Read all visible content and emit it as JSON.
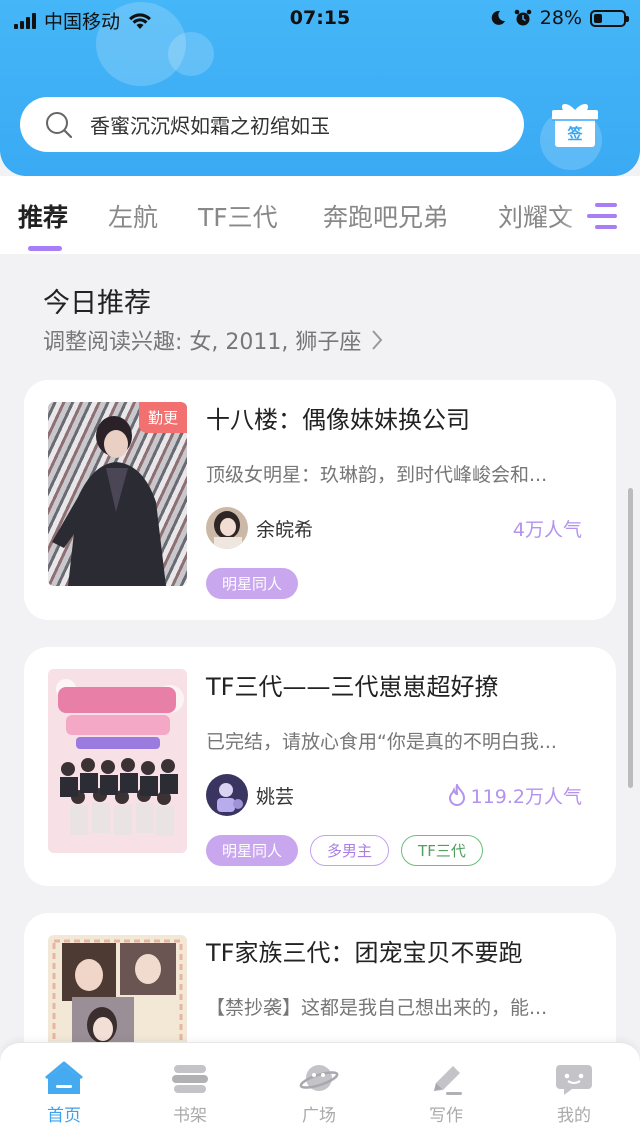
{
  "status_bar": {
    "carrier": "中国移动",
    "time": "07:15",
    "battery": "28%",
    "battery_level": 0.28
  },
  "search": {
    "placeholder": "香蜜沉沉烬如霜之初绾如玉"
  },
  "checkin": {
    "label": "签"
  },
  "tabs": [
    {
      "label": "推荐",
      "active": true
    },
    {
      "label": "左航"
    },
    {
      "label": "TF三代"
    },
    {
      "label": "奔跑吧兄弟"
    },
    {
      "label": "刘耀文"
    }
  ],
  "section": {
    "title": "今日推荐",
    "subtitle": "调整阅读兴趣: 女, 2011, 狮子座"
  },
  "books": [
    {
      "badge": "勤更",
      "title": "十八楼：偶像妹妹换公司",
      "description": "顶级女明星：玖琳韵，到时代峰峻会和...",
      "author": "余皖希",
      "popularity": "4万人气",
      "hot": false,
      "tags": [
        {
          "label": "明星同人",
          "style": "fill"
        }
      ]
    },
    {
      "badge": "",
      "title": "TF三代——三代崽崽超好撩",
      "description": "已完结，请放心食用“你是真的不明白我...",
      "author": "姚芸",
      "popularity": "119.2万人气",
      "hot": true,
      "tags": [
        {
          "label": "明星同人",
          "style": "fill"
        },
        {
          "label": "多男主",
          "style": "out-purple"
        },
        {
          "label": "TF三代",
          "style": "out-green"
        }
      ]
    },
    {
      "badge": "",
      "title": "TF家族三代：团宠宝贝不要跑",
      "description": "【禁抄袭】这都是我自己想出来的，能...",
      "author": "",
      "popularity": "",
      "hot": false,
      "tags": []
    }
  ],
  "bottom_nav": [
    {
      "label": "首页",
      "icon": "home-icon",
      "active": true
    },
    {
      "label": "书架",
      "icon": "bookshelf-icon"
    },
    {
      "label": "广场",
      "icon": "planet-icon"
    },
    {
      "label": "写作",
      "icon": "pen-icon"
    },
    {
      "label": "我的",
      "icon": "profile-chat-icon"
    }
  ],
  "colors": {
    "header": "#3aaaf4",
    "accent": "#a77ef5",
    "nav_active": "#3ea1ee",
    "badge": "#f27070"
  }
}
